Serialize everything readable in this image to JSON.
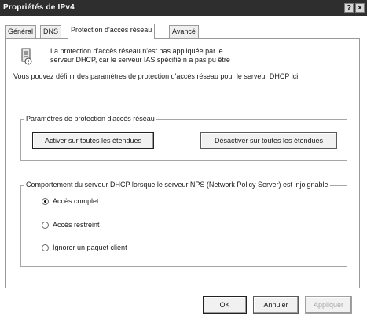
{
  "window": {
    "title": "Propriétés de IPv4",
    "help_label": "?",
    "close_label": "×"
  },
  "tabs": [
    {
      "label": "Général",
      "active": false
    },
    {
      "label": "DNS",
      "active": false
    },
    {
      "label": "Protection d'accès réseau",
      "active": true
    },
    {
      "label": "Avancé",
      "active": false
    }
  ],
  "warning": {
    "icon": "server-warning-icon",
    "line1": "La protection d'accès réseau n'est pas appliquée par le",
    "line2": "serveur DHCP, car le serveur IAS spécifié n a pas pu être"
  },
  "info_text": "Vous pouvez définir des paramètres de protection d'accès réseau pour le serveur DHCP ici.",
  "nap_group": {
    "title": "Paramètres de protection d'accès réseau",
    "enable_all_label": "Activer sur toutes les étendues",
    "disable_all_label": "Désactiver sur toutes les étendues"
  },
  "behavior_group": {
    "title": "Comportement du serveur DHCP lorsque le serveur NPS (Network Policy Server) est injoignable",
    "options": [
      {
        "label": "Accès complet",
        "selected": true
      },
      {
        "label": "Accès restreint",
        "selected": false
      },
      {
        "label": "Ignorer un paquet client",
        "selected": false
      }
    ]
  },
  "footer": {
    "ok_label": "OK",
    "cancel_label": "Annuler",
    "apply_label": "Appliquer"
  }
}
